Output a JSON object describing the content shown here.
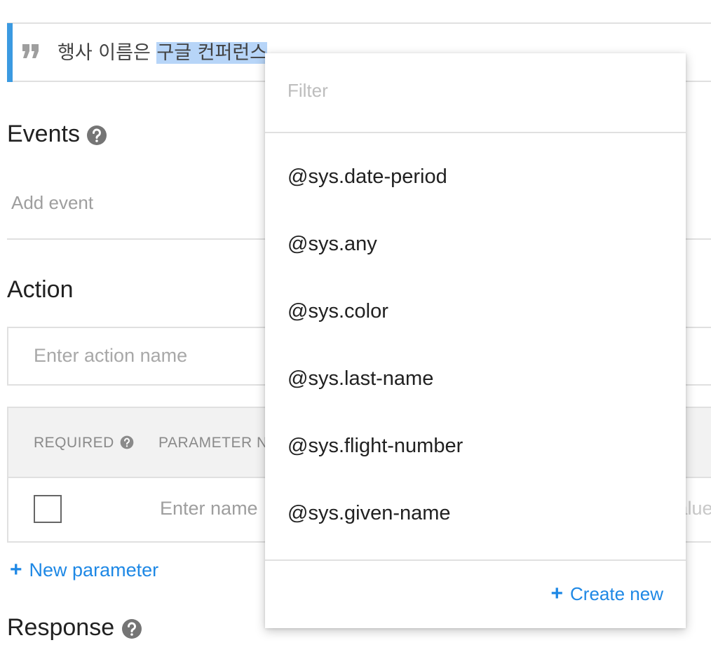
{
  "phrase": {
    "prefix": "행사 이름은 ",
    "highlight": "구글 컨퍼런스"
  },
  "events": {
    "title": "Events",
    "placeholder": "Add event"
  },
  "action": {
    "title": "Action",
    "placeholder": "Enter action name"
  },
  "parameters": {
    "col_required": "REQUIRED",
    "col_param_name": "PARAMETER NAME",
    "name_placeholder": "Enter name",
    "value_placeholder": "value",
    "new_parameter": "New parameter"
  },
  "response": {
    "title": "Response"
  },
  "dropdown": {
    "filter_placeholder": "Filter",
    "options": [
      "@sys.date-period",
      "@sys.any",
      "@sys.color",
      "@sys.last-name",
      "@sys.flight-number",
      "@sys.given-name"
    ],
    "create_new": "Create new"
  },
  "colors": {
    "accent": "#3b9ae1",
    "link": "#1e88e5",
    "highlight": "#b7d5f8"
  },
  "icons": {
    "quote": "quote-icon",
    "help": "help-circle-icon",
    "plus": "plus-icon"
  }
}
